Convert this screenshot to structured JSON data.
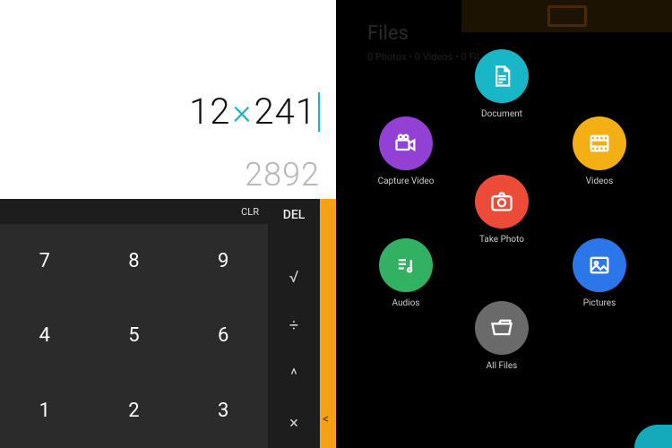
{
  "calculator": {
    "expression_left": "12",
    "operator": "×",
    "expression_right": "241",
    "result": "2892",
    "clr_label": "CLR",
    "del_label": "DEL",
    "keys": [
      "7",
      "8",
      "9",
      "4",
      "5",
      "6",
      "1",
      "2",
      "3"
    ],
    "ops": {
      "sqrt": "√",
      "divide": "÷",
      "caret": "^",
      "multiply": "×"
    },
    "expand_chevron": "<"
  },
  "files": {
    "title": "Files",
    "subtitle": "0 Photos • 0 Videos • 0 Fil",
    "options": {
      "document": "Document",
      "capture_video": "Capture Video",
      "videos": "Videos",
      "take_photo": "Take Photo",
      "audios": "Audios",
      "pictures": "Pictures",
      "all_files": "All Files"
    }
  }
}
